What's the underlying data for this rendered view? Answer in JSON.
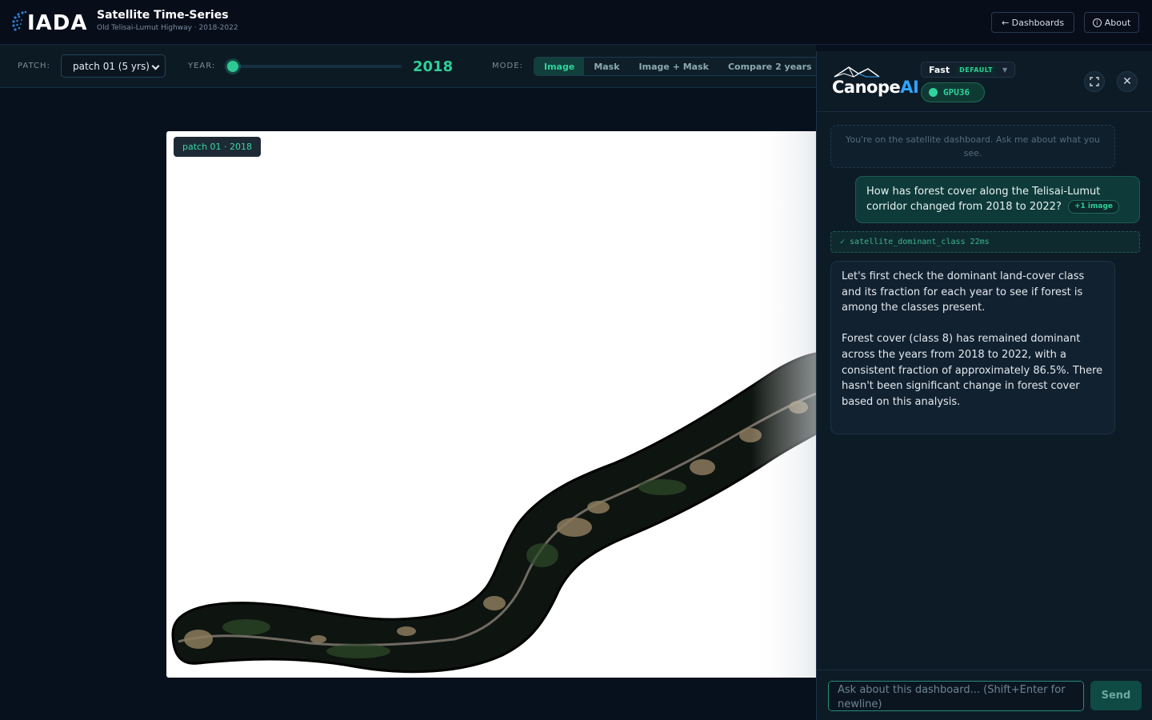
{
  "header": {
    "logo_text": "IADA",
    "title": "Satellite Time-Series",
    "subtitle": "Old Telisai-Lumut Highway · 2018-2022",
    "dashboards_label": "← Dashboards",
    "about_label": "About",
    "about_icon": "info-icon"
  },
  "controls": {
    "patch_label": "PATCH:",
    "patch_value": "patch 01 (5 yrs)",
    "year_label": "YEAR:",
    "year_value": "2018",
    "year_slider_position": 0,
    "mode_label": "MODE:",
    "modes": [
      "Image",
      "Mask",
      "Image + Mask",
      "Compare 2 years"
    ],
    "active_mode": "Image"
  },
  "viewer": {
    "patch_tag": "patch 01 · 2018"
  },
  "chat": {
    "brand_main": "Canope",
    "brand_accent": "AI",
    "model_name": "Fast",
    "model_badge": "DEFAULT",
    "gpu_label": "GPU36",
    "gpu_status_color": "#2fd39c",
    "system_message": "You're on the satellite dashboard. Ask me about what you see.",
    "user_message": "How has forest cover along the Telisai-Lumut corridor changed from 2018 to 2022?",
    "user_attachment": "+1 image",
    "tool_call": "✓ satellite_dominant_class 22ms",
    "assistant_paragraphs": [
      "Let's first check the dominant land-cover class and its fraction for each year to see if forest is among the classes present.",
      "Forest cover (class 8) has remained dominant across the years from 2018 to 2022, with a consistent fraction of approximately 86.5%. There hasn't been significant change in forest cover based on this analysis."
    ],
    "input_placeholder": "Ask about this dashboard... (Shift+Enter for newline)",
    "send_label": "Send"
  },
  "colors": {
    "accent": "#2fcf98",
    "background": "#07101d",
    "panel": "#0d1b27"
  }
}
